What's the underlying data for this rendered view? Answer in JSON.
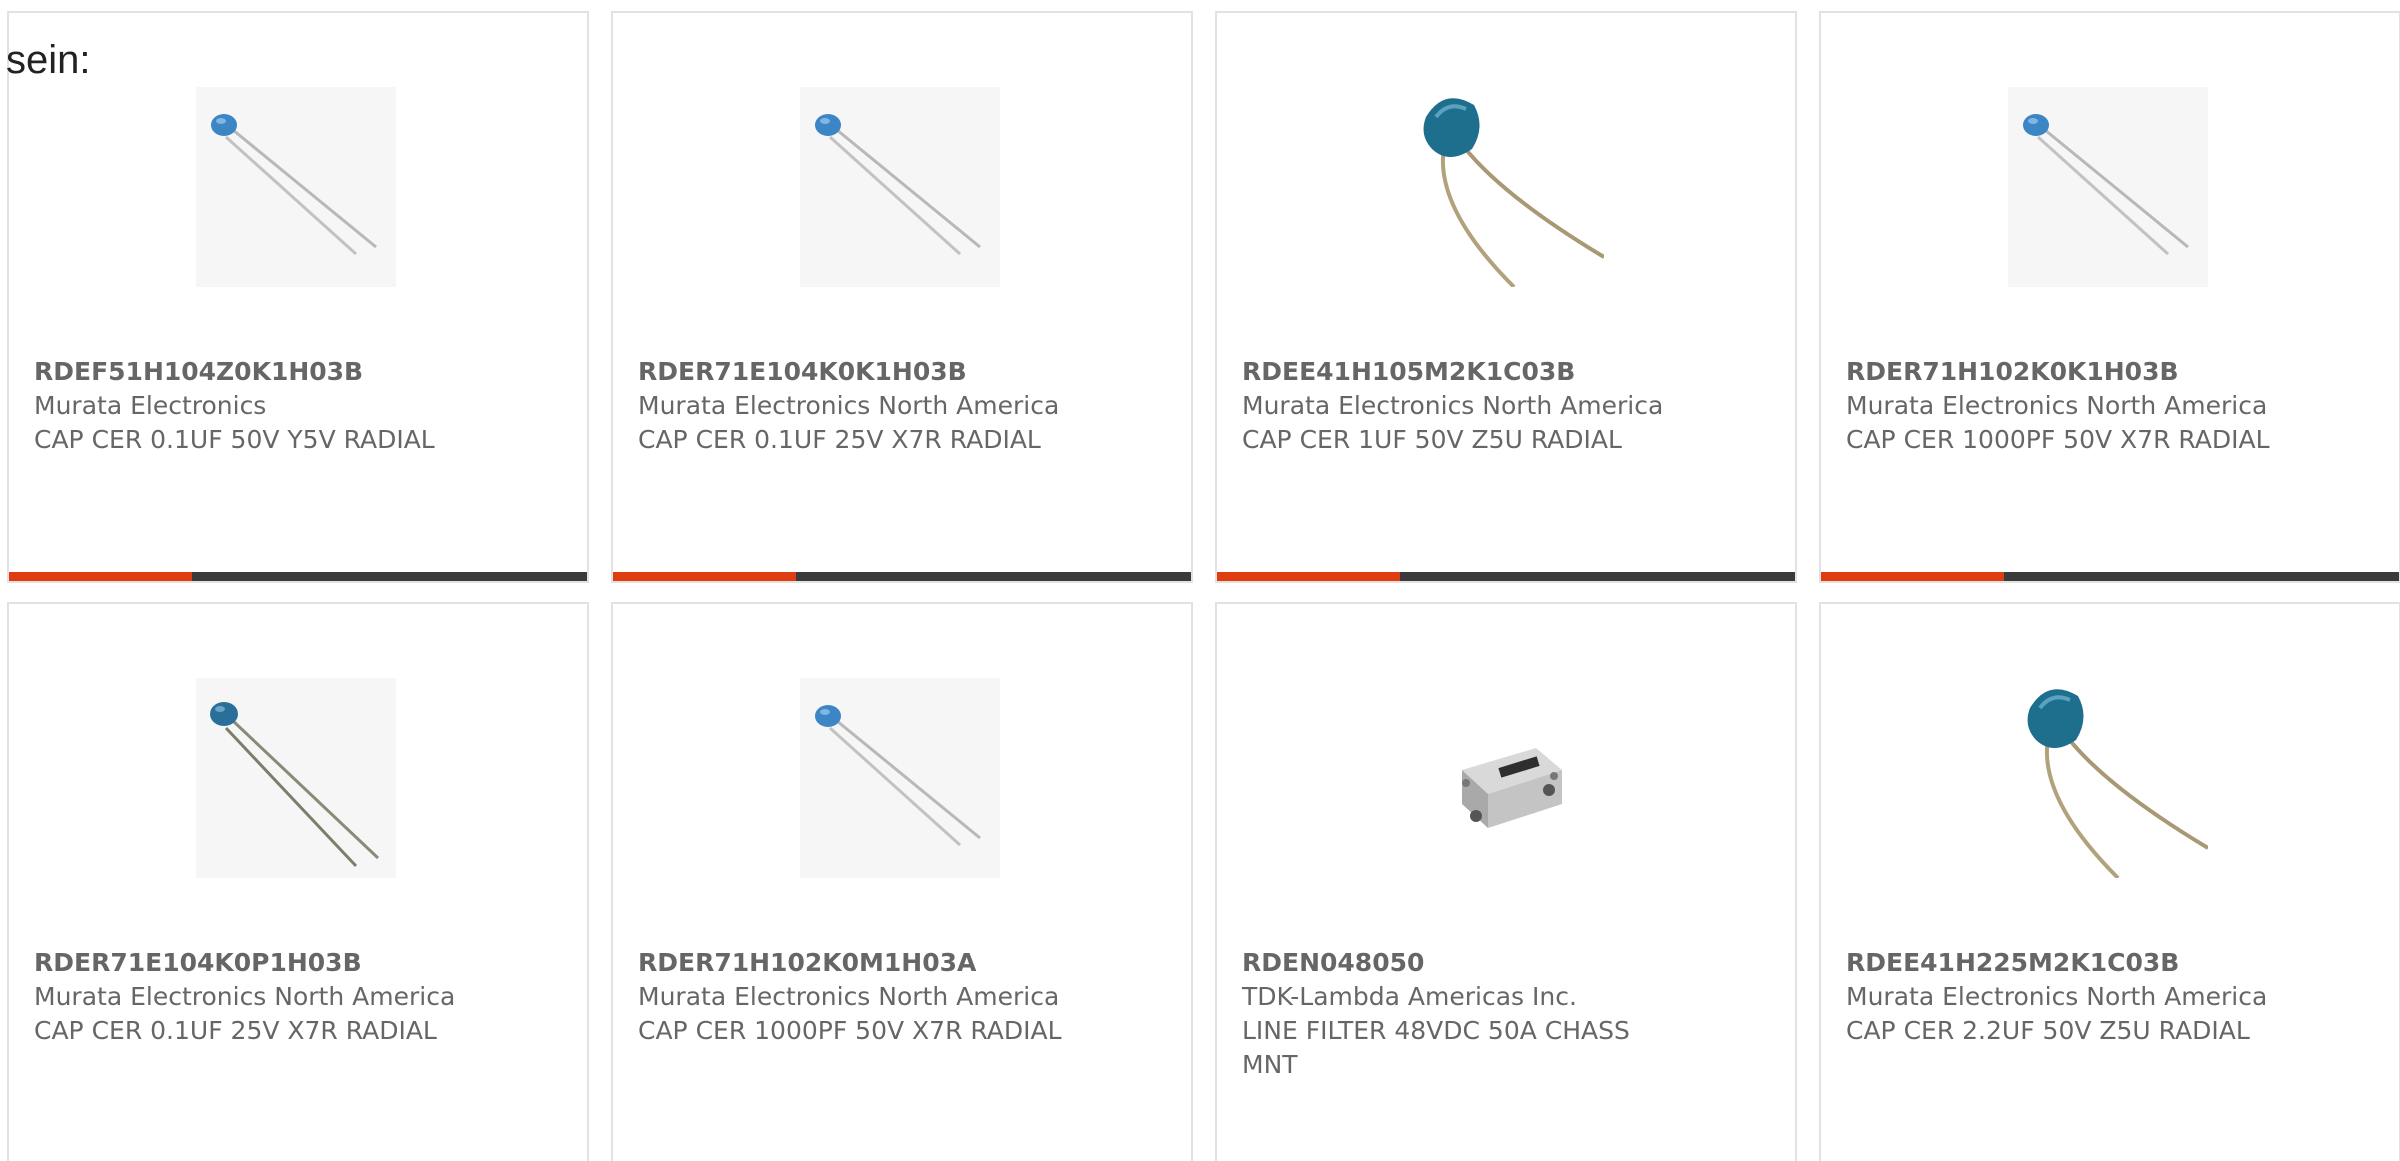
{
  "intro_text": "sein:",
  "accent_color": "#e03c12",
  "bar_color": "#3a3a3a",
  "products": [
    {
      "part": "RDEF51H104Z0K1H03B",
      "manufacturer": "Murata Electronics",
      "description": "CAP CER 0.1UF 50V Y5V RADIAL",
      "image": "ceramic-capacitor-small-icon"
    },
    {
      "part": "RDER71E104K0K1H03B",
      "manufacturer": "Murata Electronics North America",
      "description": "CAP CER 0.1UF 25V X7R RADIAL",
      "image": "ceramic-capacitor-small-icon"
    },
    {
      "part": "RDEE41H105M2K1C03B",
      "manufacturer": "Murata Electronics North America",
      "description": "CAP CER 1UF 50V Z5U RADIAL",
      "image": "ceramic-capacitor-large-icon"
    },
    {
      "part": "RDER71H102K0K1H03B",
      "manufacturer": "Murata Electronics North America",
      "description": "CAP CER 1000PF 50V X7R RADIAL",
      "image": "ceramic-capacitor-small-icon"
    },
    {
      "part": "RDER71E104K0P1H03B",
      "manufacturer": "Murata Electronics North America",
      "description": "CAP CER 0.1UF 25V X7R RADIAL",
      "image": "ceramic-capacitor-dark-icon"
    },
    {
      "part": "RDER71H102K0M1H03A",
      "manufacturer": "Murata Electronics North America",
      "description": "CAP CER 1000PF 50V X7R RADIAL",
      "image": "ceramic-capacitor-small-icon"
    },
    {
      "part": "RDEN048050",
      "manufacturer": "TDK-Lambda Americas Inc.",
      "description": "LINE FILTER 48VDC 50A CHASS MNT",
      "image": "line-filter-icon"
    },
    {
      "part": "RDEE41H225M2K1C03B",
      "manufacturer": "Murata Electronics North America",
      "description": "CAP CER 2.2UF 50V Z5U RADIAL",
      "image": "ceramic-capacitor-large-icon"
    }
  ]
}
